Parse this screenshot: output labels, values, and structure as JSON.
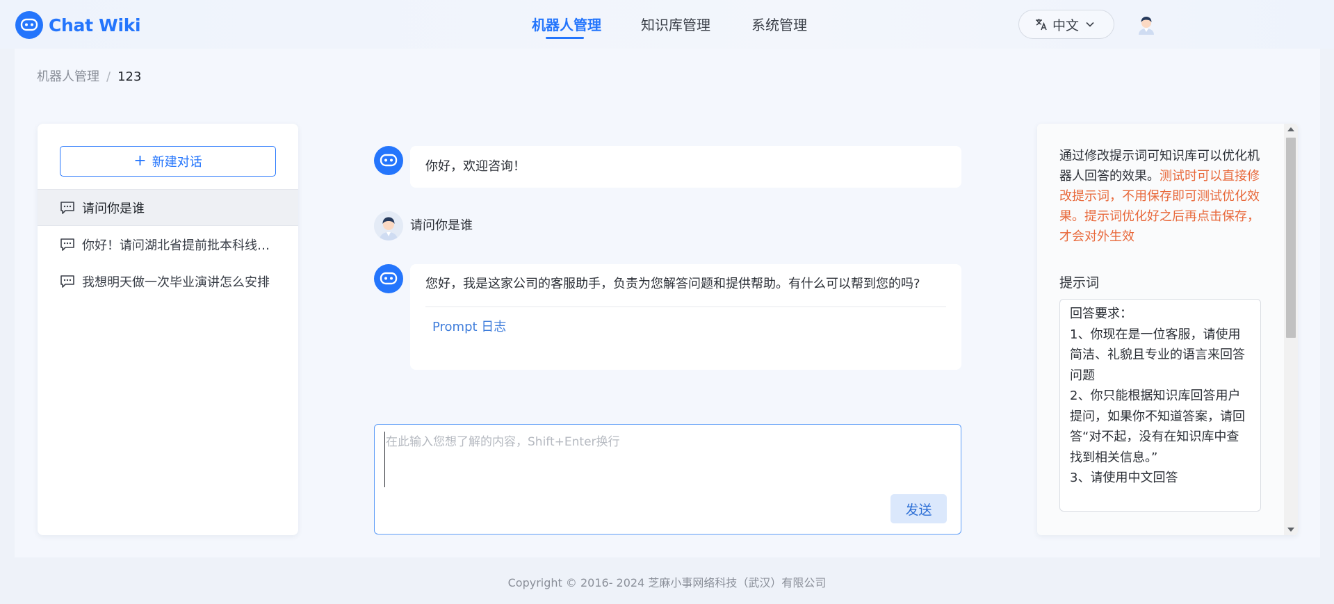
{
  "brand": {
    "name": "Chat Wiki",
    "accent": "#2475fc"
  },
  "nav": {
    "items": [
      {
        "label": "机器人管理",
        "active": true
      },
      {
        "label": "知识库管理",
        "active": false
      },
      {
        "label": "系统管理",
        "active": false
      }
    ]
  },
  "language": {
    "label": "中文",
    "icon": "translate-icon"
  },
  "breadcrumb": {
    "parent": "机器人管理",
    "separator": "/",
    "current": "123"
  },
  "sidebar": {
    "new_chat_label": "新建对话",
    "conversations": [
      {
        "title": "请问你是谁",
        "active": true
      },
      {
        "title": "你好！请问湖北省提前批本科线是多少",
        "active": false
      },
      {
        "title": "我想明天做一次毕业演讲怎么安排",
        "active": false
      }
    ]
  },
  "chat": {
    "messages": [
      {
        "role": "bot",
        "text": "你好，欢迎咨询！"
      },
      {
        "role": "user",
        "text": "请问你是谁"
      },
      {
        "role": "bot",
        "text": "您好，我是这家公司的客服助手，负责为您解答问题和提供帮助。有什么可以帮到您的吗?",
        "link": "Prompt 日志"
      }
    ],
    "input_placeholder": "在此输入您想了解的内容，Shift+Enter换行",
    "send_label": "发送"
  },
  "settings": {
    "tip_normal": "通过修改提示词可知识库可以优化机器人回答的效果。",
    "tip_warning": "测试时可以直接修改提示词，不用保存即可测试优化效果。提示词优化好之后再点击保存，才会对外生效",
    "warning_color": "#e8683a",
    "prompt_label": "提示词",
    "prompt_text": "回答要求：\n1、你现在是一位客服，请使用简洁、礼貌且专业的语言来回答问题\n2、你只能根据知识库回答用户提问，如果你不知道答案，请回答“对不起，没有在知识库中查找到相关信息。”\n3、请使用中文回答"
  },
  "footer": {
    "copyright": "Copyright © 2016- 2024 芝麻小事网络科技（武汉）有限公司"
  }
}
